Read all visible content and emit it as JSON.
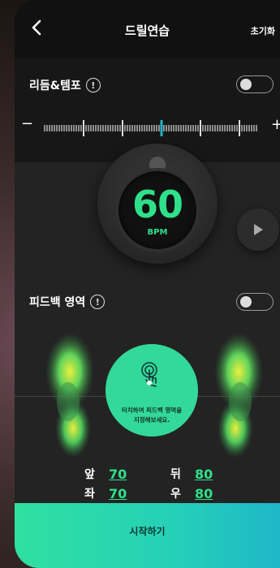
{
  "header": {
    "title": "드릴연습",
    "reset_label": "초기화",
    "back_icon": "chevron-left-icon"
  },
  "rhythm": {
    "label": "리듬&템포",
    "info_glyph": "!",
    "toggle_on": false,
    "minus_label": "−",
    "plus_label": "+"
  },
  "metronome": {
    "bpm_value": "60",
    "bpm_unit": "BPM",
    "play_icon": "play-icon"
  },
  "feedback": {
    "label": "피드백 영역",
    "info_glyph": "!",
    "toggle_on": false,
    "touch_text_line1": "터치하여 피드백 영역을",
    "touch_text_line2": "지정해보세요.",
    "touch_icon": "touch-hand-icon"
  },
  "balance": {
    "front_label": "앞",
    "front_value": "70",
    "back_label": "뒤",
    "back_value": "80",
    "left_label": "좌",
    "left_value": "70",
    "right_label": "우",
    "right_value": "80"
  },
  "footer": {
    "start_label": "시작하기"
  },
  "colors": {
    "accent_green": "#2fe08a",
    "touch_circle": "#33d99a",
    "tick_accent": "#1fb7c8"
  }
}
